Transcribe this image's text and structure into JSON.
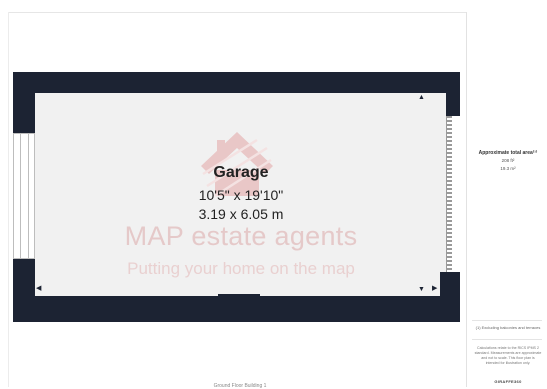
{
  "room": {
    "name": "Garage",
    "imperial": "10'5\" x 19'10\"",
    "metric": "3.19 x 6.05 m"
  },
  "watermark": {
    "brand": "MAP estate agents",
    "tagline": "Putting your home on the map",
    "icon": "house-logo-icon",
    "color": "#e5c9c9"
  },
  "side_panel": {
    "area_title": "Approximate total area⁽¹⁾",
    "area_sqft": "208 ft²",
    "area_sqm": "19.3 m²",
    "footnote": "(1) Excluding balconies and terraces",
    "disclaimer": "Calculations relate to the RICS IPMS 2 standard. Measurements are approximate and not to scale. This floor plan is intended for illustration only.",
    "brand_mark": "GIRAFFE360"
  },
  "floor_caption": "Ground Floor Building 1",
  "colors": {
    "wall": "#1c2333",
    "floor": "#f1f1f1"
  }
}
